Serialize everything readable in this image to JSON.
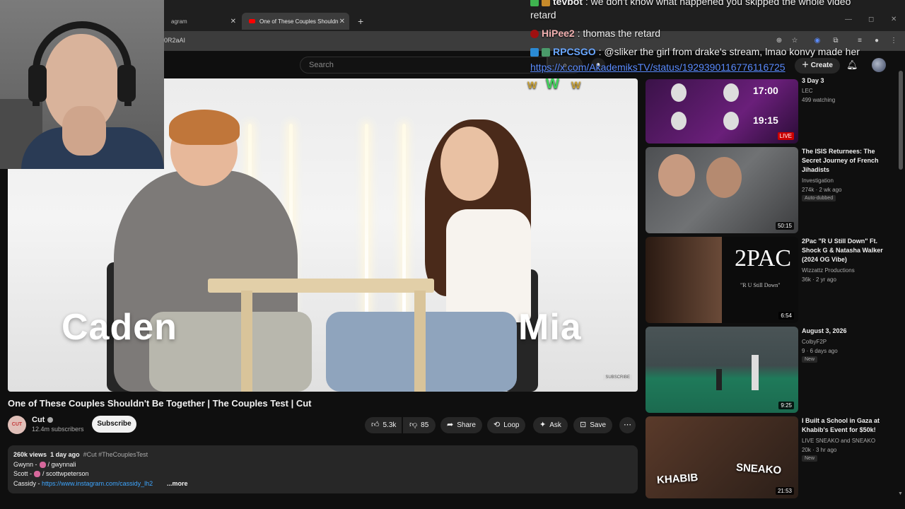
{
  "browser": {
    "tabs": [
      {
        "label": "agram"
      },
      {
        "label": "One of These Couples Shouldn"
      }
    ],
    "url": "0R2aAI"
  },
  "yt_header": {
    "search_placeholder": "Search",
    "create_label": "Create"
  },
  "player": {
    "name_left": "Caden",
    "name_right": "Mia",
    "watermark": "SUBSCRIBE"
  },
  "video": {
    "title": "One of These Couples Shouldn't Be Together | The Couples Test | Cut",
    "channel_avatar_text": "CUT",
    "channel_name": "Cut",
    "subscribers": "12.4m subscribers",
    "subscribe_label": "Subscribe",
    "likes": "5.3k",
    "dislikes": "85",
    "share_label": "Share",
    "loop_label": "Loop",
    "ask_label": "Ask",
    "save_label": "Save"
  },
  "description": {
    "views": "260k views",
    "age": "1 day ago",
    "hashtags": "#Cut #TheCouplesTest",
    "lines": [
      {
        "name": "Gwynn -",
        "handle": "/ gwynnali"
      },
      {
        "name": "Scott -",
        "handle": "/ scottwpeterson"
      }
    ],
    "cassidy_label": "Cassidy -",
    "cassidy_link": "https://www.instagram.com/cassidy_lh2",
    "more": "...more"
  },
  "recommendations": [
    {
      "title": "3 Day 3",
      "channel": "LEC",
      "meta": "499 watching",
      "badge": "LIVE",
      "score_a": "17:00",
      "score_b": "19:15"
    },
    {
      "title": "The ISIS Returnees: The Secret Journey of French Jihadists",
      "channel": "Investigation",
      "meta": "274k · 2 wk ago",
      "tag": "Auto-dubbed",
      "duration": "50:15"
    },
    {
      "title": "2Pac \"R U Still Down\" Ft. Shock G & Natasha Walker (2024 OG Vibe)",
      "channel": "Wizzattz Productions",
      "meta": "36k · 2 yr ago",
      "duration": "6:54",
      "thumb_text": "2PAC",
      "thumb_sub": "\"R U Still Down\""
    },
    {
      "title": "August 3, 2026",
      "channel": "ColbyF2P",
      "meta": "9 · 6 days ago",
      "tag": "New",
      "duration": "9:25"
    },
    {
      "title": "I Built a School in Gaza at Khabib's Event for $50k!",
      "channel": "LIVE SNEAKO and SNEAKO",
      "meta": "20k · 3 hr ago",
      "tag": "New",
      "duration": "21:53",
      "thumb_left": "KHABIB",
      "thumb_right": "SNEAKO"
    }
  ],
  "chat": [
    {
      "user": "tevbot",
      "text": ": we don't know what happened you skipped the whole video",
      "cont": "retard"
    },
    {
      "user": "HiPee2",
      "text": ": thomas the retard"
    },
    {
      "user": "RPCSGO",
      "text": ": @sliker the girl from drake's stream, lmao konvy made her",
      "link": "https://x.com/AkademiksTV/status/1929390116776116725"
    }
  ],
  "emotes": [
    "W",
    "W",
    "W"
  ],
  "colors": {
    "accent_red": "#ff0000",
    "link_blue": "#3ea6ff",
    "bg": "#0f0f0f"
  }
}
